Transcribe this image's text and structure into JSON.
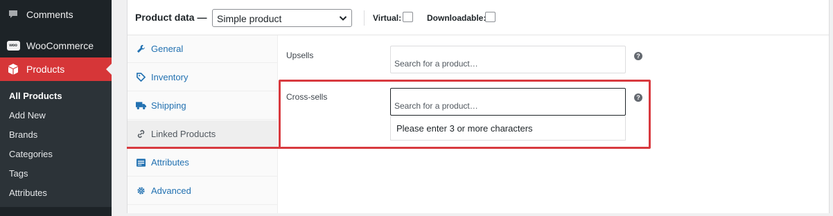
{
  "sidebar": {
    "comments": "Comments",
    "woocommerce": "WooCommerce",
    "woo_badge": "woo",
    "products": "Products",
    "submenu": [
      {
        "label": "All Products"
      },
      {
        "label": "Add New"
      },
      {
        "label": "Brands"
      },
      {
        "label": "Categories"
      },
      {
        "label": "Tags"
      },
      {
        "label": "Attributes"
      }
    ]
  },
  "product_data": {
    "title": "Product data —",
    "type_value": "Simple product",
    "virtual_label": "Virtual:",
    "downloadable_label": "Downloadable:",
    "virtual_checked": false,
    "downloadable_checked": false
  },
  "tabs": [
    {
      "label": "General",
      "icon": "wrench-icon"
    },
    {
      "label": "Inventory",
      "icon": "tag-icon"
    },
    {
      "label": "Shipping",
      "icon": "truck-icon"
    },
    {
      "label": "Linked Products",
      "icon": "link-icon"
    },
    {
      "label": "Attributes",
      "icon": "list-icon"
    },
    {
      "label": "Advanced",
      "icon": "gear-icon"
    }
  ],
  "linked": {
    "upsells_label": "Upsells",
    "upsells_placeholder": "Search for a product…",
    "crosssells_label": "Cross-sells",
    "crosssells_placeholder": "Search for a product…",
    "dropdown_message": "Please enter 3 or more characters",
    "help_glyph": "?"
  },
  "colors": {
    "sidebar_bg": "#1d2327",
    "submenu_bg": "#2c3338",
    "accent_red": "#d63638",
    "annotation_red": "#d83a3f",
    "link_blue": "#2271b1"
  }
}
